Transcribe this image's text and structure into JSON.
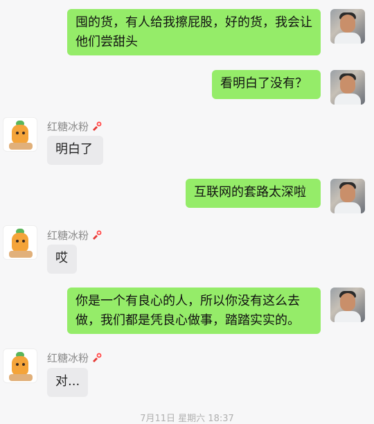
{
  "contact": {
    "name": "红糖冰粉"
  },
  "messages": [
    {
      "from": "self",
      "text": "囤的货，有人给我擦屁股，好的货，我会让他们尝甜头"
    },
    {
      "from": "self",
      "text": "看明白了没有？"
    },
    {
      "from": "other",
      "text": "明白了"
    },
    {
      "from": "self",
      "text": "互联网的套路太深啦"
    },
    {
      "from": "other",
      "text": "哎"
    },
    {
      "from": "self",
      "text": "你是一个有良心的人，所以你没有这么去做，我们都是凭良心做事，踏踏实实的。"
    },
    {
      "from": "other",
      "text": "对..."
    }
  ],
  "footer": {
    "timestamp": "7月11日 星期六 18:37"
  },
  "icons": {
    "self_avatar": "user-avatar-photo",
    "other_avatar": "carrot-cartoon-avatar",
    "name_badge": "red-bow-badge-icon"
  },
  "colors": {
    "self_bubble": "#95ec69",
    "other_bubble": "#eaeaec",
    "background": "#f7f7f8"
  }
}
